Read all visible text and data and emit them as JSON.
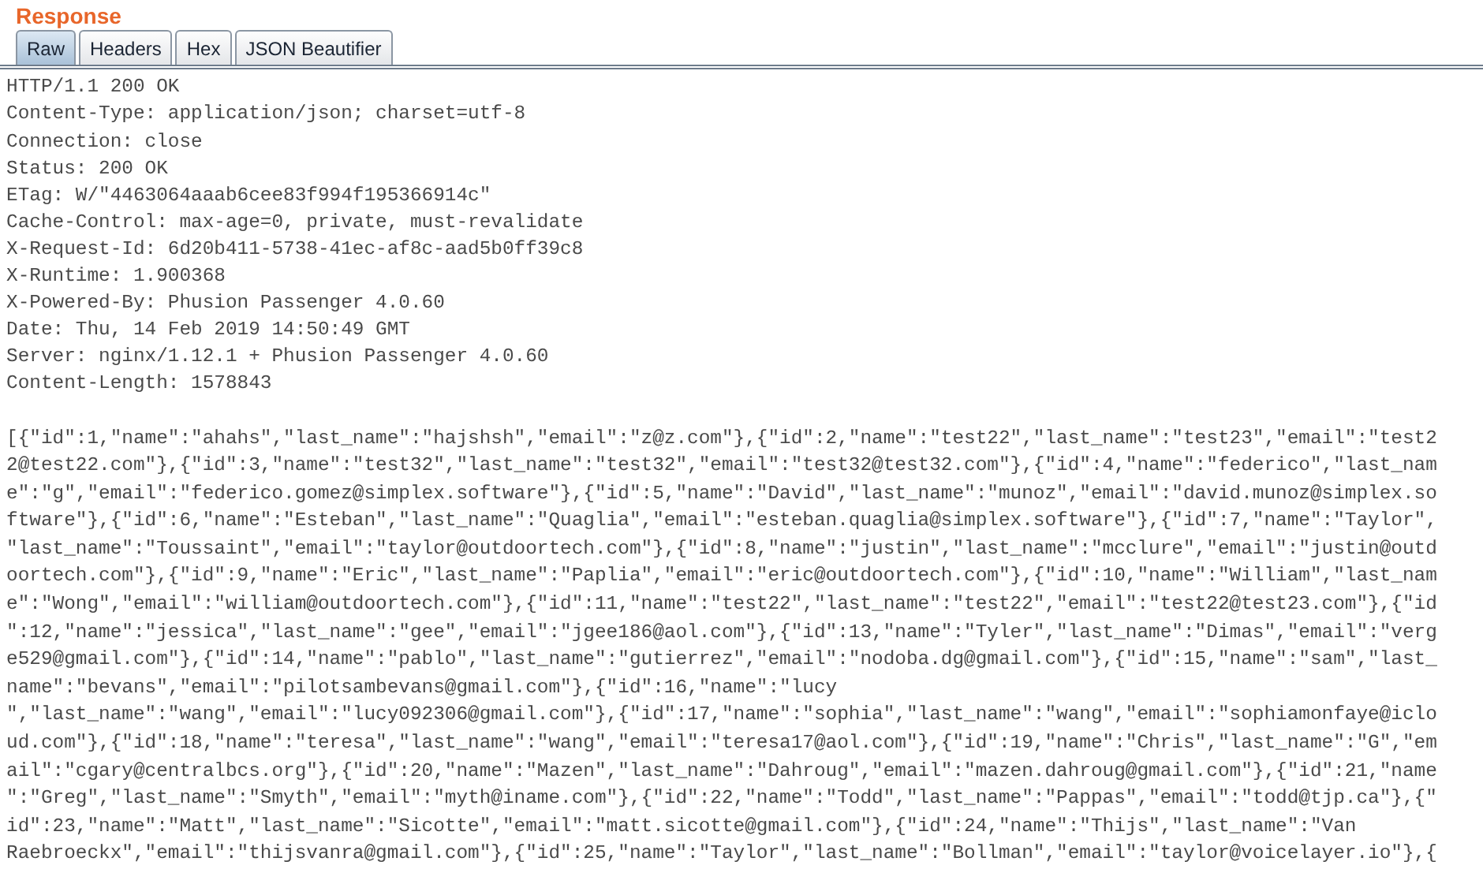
{
  "title": "Response",
  "tabs": [
    {
      "label": "Raw",
      "selected": true
    },
    {
      "label": "Headers",
      "selected": false
    },
    {
      "label": "Hex",
      "selected": false
    },
    {
      "label": "JSON Beautifier",
      "selected": false
    }
  ],
  "headers": [
    "HTTP/1.1 200 OK",
    "Content-Type: application/json; charset=utf-8",
    "Connection: close",
    "Status: 200 OK",
    "ETag: W/\"4463064aaab6cee83f994f195366914c\"",
    "Cache-Control: max-age=0, private, must-revalidate",
    "X-Request-Id: 6d20b411-5738-41ec-af8c-aad5b0ff39c8",
    "X-Runtime: 1.900368",
    "X-Powered-By: Phusion Passenger 4.0.60",
    "Date: Thu, 14 Feb 2019 14:50:49 GMT",
    "Server: nginx/1.12.1 + Phusion Passenger 4.0.60",
    "Content-Length: 1578843"
  ],
  "body_lines": [
    "[{\"id\":1,\"name\":\"ahahs\",\"last_name\":\"hajshsh\",\"email\":\"z@z.com\"},{\"id\":2,\"name\":\"test22\",\"last_name\":\"test23\",\"email\":\"test2",
    "2@test22.com\"},{\"id\":3,\"name\":\"test32\",\"last_name\":\"test32\",\"email\":\"test32@test32.com\"},{\"id\":4,\"name\":\"federico\",\"last_nam",
    "e\":\"g\",\"email\":\"federico.gomez@simplex.software\"},{\"id\":5,\"name\":\"David\",\"last_name\":\"munoz\",\"email\":\"david.munoz@simplex.so",
    "ftware\"},{\"id\":6,\"name\":\"Esteban\",\"last_name\":\"Quaglia\",\"email\":\"esteban.quaglia@simplex.software\"},{\"id\":7,\"name\":\"Taylor\",",
    "\"last_name\":\"Toussaint\",\"email\":\"taylor@outdoortech.com\"},{\"id\":8,\"name\":\"justin\",\"last_name\":\"mcclure\",\"email\":\"justin@outd",
    "oortech.com\"},{\"id\":9,\"name\":\"Eric\",\"last_name\":\"Paplia\",\"email\":\"eric@outdoortech.com\"},{\"id\":10,\"name\":\"William\",\"last_nam",
    "e\":\"Wong\",\"email\":\"william@outdoortech.com\"},{\"id\":11,\"name\":\"test22\",\"last_name\":\"test22\",\"email\":\"test22@test23.com\"},{\"id",
    "\":12,\"name\":\"jessica\",\"last_name\":\"gee\",\"email\":\"jgee186@aol.com\"},{\"id\":13,\"name\":\"Tyler\",\"last_name\":\"Dimas\",\"email\":\"verg",
    "e529@gmail.com\"},{\"id\":14,\"name\":\"pablo\",\"last_name\":\"gutierrez\",\"email\":\"nodoba.dg@gmail.com\"},{\"id\":15,\"name\":\"sam\",\"last_",
    "name\":\"bevans\",\"email\":\"pilotsambevans@gmail.com\"},{\"id\":16,\"name\":\"lucy",
    "\",\"last_name\":\"wang\",\"email\":\"lucy092306@gmail.com\"},{\"id\":17,\"name\":\"sophia\",\"last_name\":\"wang\",\"email\":\"sophiamonfaye@iclo",
    "ud.com\"},{\"id\":18,\"name\":\"teresa\",\"last_name\":\"wang\",\"email\":\"teresa17@aol.com\"},{\"id\":19,\"name\":\"Chris\",\"last_name\":\"G\",\"em",
    "ail\":\"cgary@centralbcs.org\"},{\"id\":20,\"name\":\"Mazen\",\"last_name\":\"Dahroug\",\"email\":\"mazen.dahroug@gmail.com\"},{\"id\":21,\"name",
    "\":\"Greg\",\"last_name\":\"Smyth\",\"email\":\"myth@iname.com\"},{\"id\":22,\"name\":\"Todd\",\"last_name\":\"Pappas\",\"email\":\"todd@tjp.ca\"},{\"",
    "id\":23,\"name\":\"Matt\",\"last_name\":\"Sicotte\",\"email\":\"matt.sicotte@gmail.com\"},{\"id\":24,\"name\":\"Thijs\",\"last_name\":\"Van",
    "Raebroeckx\",\"email\":\"thijsvanra@gmail.com\"},{\"id\":25,\"name\":\"Taylor\",\"last_name\":\"Bollman\",\"email\":\"taylor@voicelayer.io\"},{"
  ]
}
